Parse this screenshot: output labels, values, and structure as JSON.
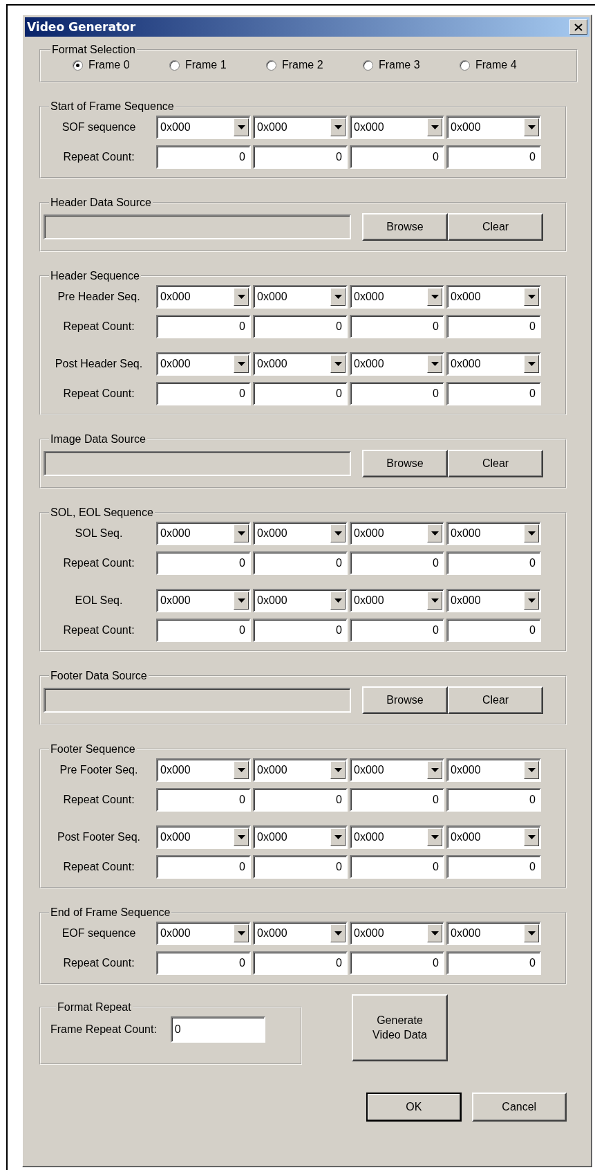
{
  "window": {
    "title": "Video Generator"
  },
  "format_selection": {
    "title": "Format Selection",
    "options": [
      {
        "label": "Frame 0",
        "selected": true
      },
      {
        "label": "Frame 1",
        "selected": false
      },
      {
        "label": "Frame 2",
        "selected": false
      },
      {
        "label": "Frame 3",
        "selected": false
      },
      {
        "label": "Frame 4",
        "selected": false
      }
    ]
  },
  "sections": [
    {
      "kind": "sequence",
      "title": "Start of Frame Sequence",
      "groups": [
        {
          "rows": [
            {
              "kind": "combo",
              "label": "SOF sequence",
              "values": [
                "0x000",
                "0x000",
                "0x000",
                "0x000"
              ]
            },
            {
              "kind": "count",
              "label": "Repeat Count:",
              "values": [
                "0",
                "0",
                "0",
                "0"
              ]
            }
          ]
        }
      ]
    },
    {
      "kind": "source",
      "title": "Header Data Source",
      "buttons": [
        "Browse",
        "Clear"
      ]
    },
    {
      "kind": "sequence",
      "title": "Header Sequence",
      "groups": [
        {
          "rows": [
            {
              "kind": "combo",
              "label": "Pre Header Seq.",
              "values": [
                "0x000",
                "0x000",
                "0x000",
                "0x000"
              ]
            },
            {
              "kind": "count",
              "label": "Repeat Count:",
              "values": [
                "0",
                "0",
                "0",
                "0"
              ]
            }
          ]
        },
        {
          "rows": [
            {
              "kind": "combo",
              "label": "Post Header Seq.",
              "values": [
                "0x000",
                "0x000",
                "0x000",
                "0x000"
              ]
            },
            {
              "kind": "count",
              "label": "Repeat Count:",
              "values": [
                "0",
                "0",
                "0",
                "0"
              ]
            }
          ]
        }
      ]
    },
    {
      "kind": "source",
      "title": "Image Data Source",
      "buttons": [
        "Browse",
        "Clear"
      ]
    },
    {
      "kind": "sequence",
      "title": "SOL, EOL Sequence",
      "groups": [
        {
          "rows": [
            {
              "kind": "combo",
              "label": "SOL Seq.",
              "values": [
                "0x000",
                "0x000",
                "0x000",
                "0x000"
              ]
            },
            {
              "kind": "count",
              "label": "Repeat Count:",
              "values": [
                "0",
                "0",
                "0",
                "0"
              ]
            }
          ]
        },
        {
          "rows": [
            {
              "kind": "combo",
              "label": "EOL Seq.",
              "values": [
                "0x000",
                "0x000",
                "0x000",
                "0x000"
              ]
            },
            {
              "kind": "count",
              "label": "Repeat Count:",
              "values": [
                "0",
                "0",
                "0",
                "0"
              ]
            }
          ]
        }
      ]
    },
    {
      "kind": "source",
      "title": "Footer Data Source",
      "buttons": [
        "Browse",
        "Clear"
      ]
    },
    {
      "kind": "sequence",
      "title": "Footer Sequence",
      "groups": [
        {
          "rows": [
            {
              "kind": "combo",
              "label": "Pre Footer Seq.",
              "values": [
                "0x000",
                "0x000",
                "0x000",
                "0x000"
              ]
            },
            {
              "kind": "count",
              "label": "Repeat Count:",
              "values": [
                "0",
                "0",
                "0",
                "0"
              ]
            }
          ]
        },
        {
          "rows": [
            {
              "kind": "combo",
              "label": "Post Footer Seq.",
              "values": [
                "0x000",
                "0x000",
                "0x000",
                "0x000"
              ]
            },
            {
              "kind": "count",
              "label": "Repeat Count:",
              "values": [
                "0",
                "0",
                "0",
                "0"
              ]
            }
          ]
        }
      ]
    },
    {
      "kind": "sequence",
      "title": "End of Frame Sequence",
      "groups": [
        {
          "rows": [
            {
              "kind": "combo",
              "label": "EOF sequence",
              "values": [
                "0x000",
                "0x000",
                "0x000",
                "0x000"
              ]
            },
            {
              "kind": "count",
              "label": "Repeat Count:",
              "values": [
                "0",
                "0",
                "0",
                "0"
              ]
            }
          ]
        }
      ]
    }
  ],
  "format_repeat": {
    "title": "Format Repeat",
    "label": "Frame Repeat Count:",
    "value": "0"
  },
  "generate_button": "Generate Video Data",
  "buttons": [
    "OK",
    "Cancel"
  ]
}
